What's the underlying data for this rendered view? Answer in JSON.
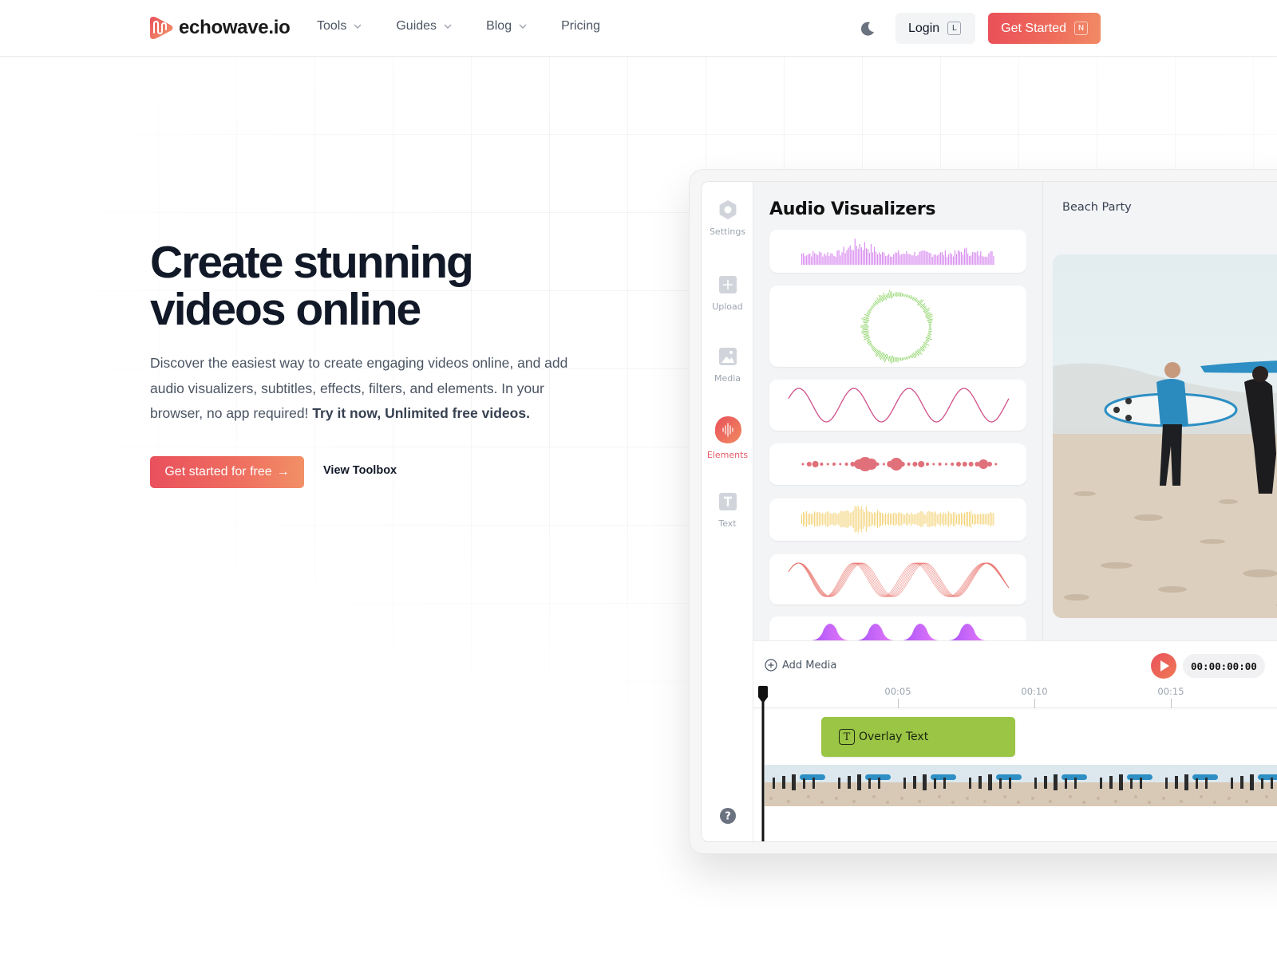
{
  "nav": {
    "brand": "echowave.io",
    "links": [
      {
        "label": "Tools",
        "has_dropdown": true
      },
      {
        "label": "Guides",
        "has_dropdown": true
      },
      {
        "label": "Blog",
        "has_dropdown": true
      },
      {
        "label": "Pricing",
        "has_dropdown": false
      }
    ],
    "theme_toggle_icon": "moon-icon",
    "login_label": "Login",
    "login_shortcut": "L",
    "get_started_label": "Get Started",
    "get_started_shortcut": "N"
  },
  "hero": {
    "title_line1": "Create stunning",
    "title_line2": "videos online",
    "description": "Discover the easiest way to create engaging videos online, and add audio visualizers, subtitles, effects, filters, and elements. In your browser, no app required! ",
    "description_bold": "Try it now, Unlimited free videos.",
    "cta_label": "Get started for free",
    "cta_arrow": "→",
    "secondary_label": "View Toolbox"
  },
  "app": {
    "sidebar": [
      {
        "label": "Settings",
        "icon": "settings-icon",
        "active": false
      },
      {
        "label": "Upload",
        "icon": "upload-icon",
        "active": false
      },
      {
        "label": "Media",
        "icon": "media-icon",
        "active": false
      },
      {
        "label": "Elements",
        "icon": "elements-icon",
        "active": true
      },
      {
        "label": "Text",
        "icon": "text-icon",
        "active": false
      }
    ],
    "help_icon": "help-icon",
    "panel_title": "Audio Visualizers",
    "visualizers": [
      {
        "name": "bar-spectrum",
        "color": "#d98cf0"
      },
      {
        "name": "circular-wave",
        "color": "#8fd46a"
      },
      {
        "name": "sine-line",
        "color": "#d0508a"
      },
      {
        "name": "dot-wave",
        "color": "#e0707a"
      },
      {
        "name": "mirrored-bars",
        "color": "#f3d070"
      },
      {
        "name": "multi-sine",
        "color": "#e8746e"
      },
      {
        "name": "blob-peaks",
        "color": "#b060e8"
      }
    ],
    "preview_title": "Beach Party",
    "timeline": {
      "add_media_label": "Add Media",
      "timecode": "00:00:00:00",
      "ticks": [
        "00:05",
        "00:10",
        "00:15"
      ],
      "overlay_clip_label": "Overlay Text",
      "overlay_clip_icon": "T",
      "overlay_color": "#9bc545"
    }
  },
  "colors": {
    "accent_start": "#ea5059",
    "accent_end": "#f08a65",
    "text_primary": "#111827",
    "text_secondary": "#4b5563"
  }
}
